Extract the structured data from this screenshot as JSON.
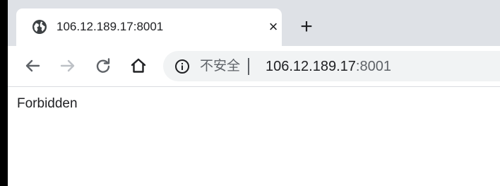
{
  "tab": {
    "title": "106.12.189.17:8001",
    "close_label": "×",
    "favicon": "globe-icon"
  },
  "new_tab": {
    "label": "+"
  },
  "toolbar": {
    "back_icon": "back-arrow-icon",
    "forward_icon": "forward-arrow-icon",
    "reload_icon": "reload-icon",
    "home_icon": "home-icon"
  },
  "omnibox": {
    "security_icon": "info-icon",
    "security_label": "不安全",
    "url_host": "106.12.189.17",
    "url_port": ":8001"
  },
  "page": {
    "body_text": "Forbidden"
  },
  "colors": {
    "tabstrip_bg": "#dee1e6",
    "omnibox_bg": "#f1f3f4",
    "text_primary": "#202124",
    "text_secondary": "#5f6368",
    "forward_disabled": "#bdc1c6"
  }
}
